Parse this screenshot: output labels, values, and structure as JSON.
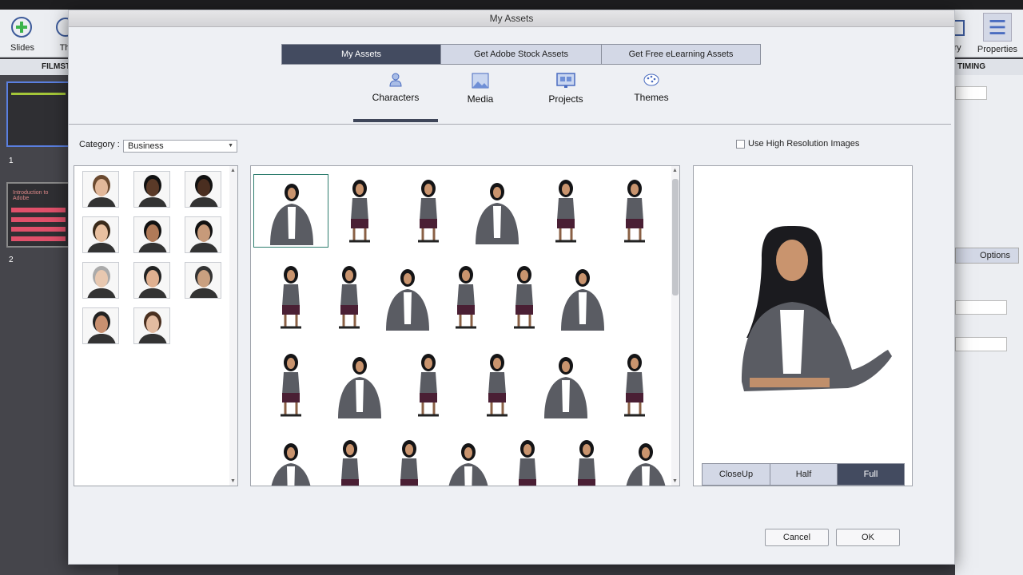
{
  "app": {
    "toolbar": {
      "slides_label": "Slides",
      "themes_label": "Th",
      "library_label": "ary",
      "properties_label": "Properties"
    },
    "panels": {
      "filmstrip_label": "FILMST",
      "timing_label": "TIMING",
      "options_label": "Options"
    },
    "slides": [
      {
        "number": "1"
      },
      {
        "number": "2",
        "title": "Introduction to Adobe"
      }
    ]
  },
  "dialog": {
    "title": "My Assets",
    "source_tabs": [
      {
        "label": "My Assets",
        "active": true
      },
      {
        "label": "Get Adobe Stock Assets"
      },
      {
        "label": "Get Free eLearning Assets"
      }
    ],
    "categories": [
      {
        "label": "Characters",
        "icon": "person-icon",
        "active": true
      },
      {
        "label": "Media",
        "icon": "image-icon"
      },
      {
        "label": "Projects",
        "icon": "projects-icon"
      },
      {
        "label": "Themes",
        "icon": "palette-icon"
      }
    ],
    "category_label": "Category :",
    "category_value": "Business",
    "high_res_label": "Use High Resolution Images",
    "high_res_checked": false,
    "characters_count": 11,
    "poses_rows": [
      6,
      6,
      6,
      7
    ],
    "view_buttons": [
      {
        "label": "CloseUp"
      },
      {
        "label": "Half"
      },
      {
        "label": "Full",
        "active": true
      }
    ],
    "cancel_label": "Cancel",
    "ok_label": "OK"
  },
  "colors": {
    "active_tab": "#434b60",
    "inactive_tab": "#d3d8e6",
    "selection": "#2e7d6e"
  }
}
